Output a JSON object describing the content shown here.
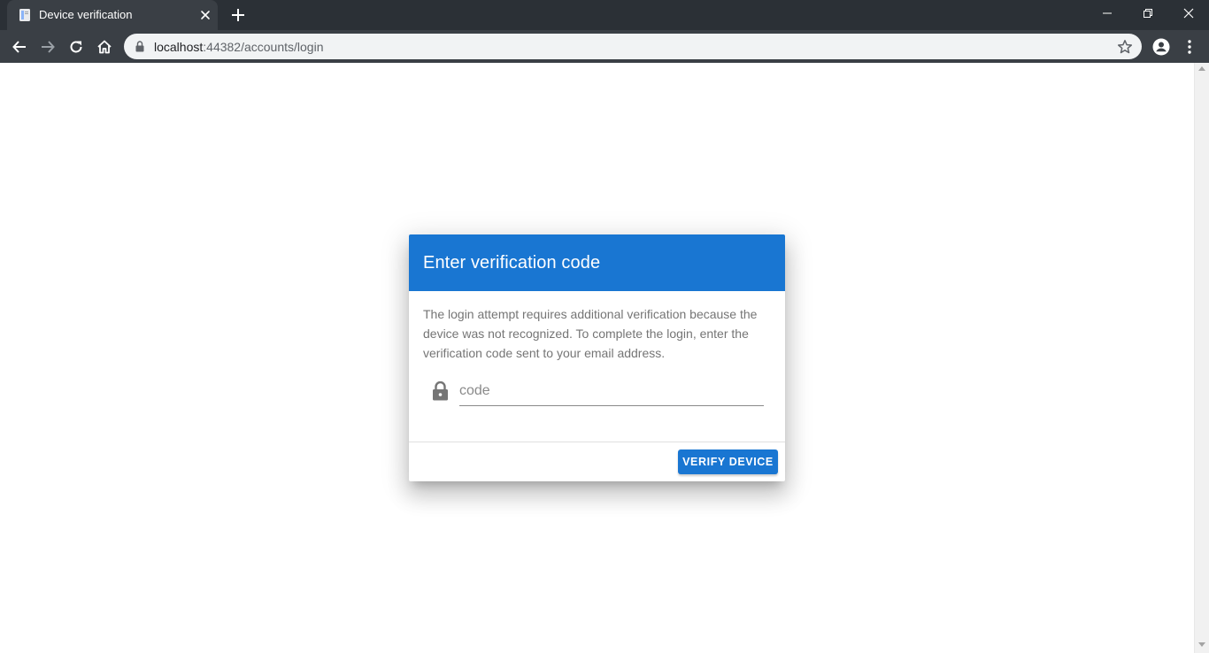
{
  "browser": {
    "tab": {
      "title": "Device verification",
      "favicon": "document-icon"
    },
    "new_tab": "plus-icon",
    "window_controls": [
      "minimize-icon",
      "restore-icon",
      "close-icon"
    ],
    "toolbar": {
      "back": "arrow-left-icon",
      "forward": "arrow-right-icon",
      "reload": "reload-icon",
      "home": "home-icon",
      "url_host": "localhost",
      "url_path": ":44382/accounts/login",
      "bookmark": "star-icon",
      "profile": "account-circle-icon",
      "menu": "kebab-menu-icon"
    }
  },
  "dialog": {
    "title": "Enter verification code",
    "message": "The login attempt requires additional verification because the device was not recognized. To complete the login, enter the verification code sent to your email address.",
    "code_input": {
      "value": "",
      "placeholder": "code",
      "icon": "lock-icon"
    },
    "verify_button": "VERIFY DEVICE"
  },
  "colors": {
    "primary": "#1976d2",
    "chrome_dark": "#3a3f45",
    "text_secondary": "#757575"
  }
}
